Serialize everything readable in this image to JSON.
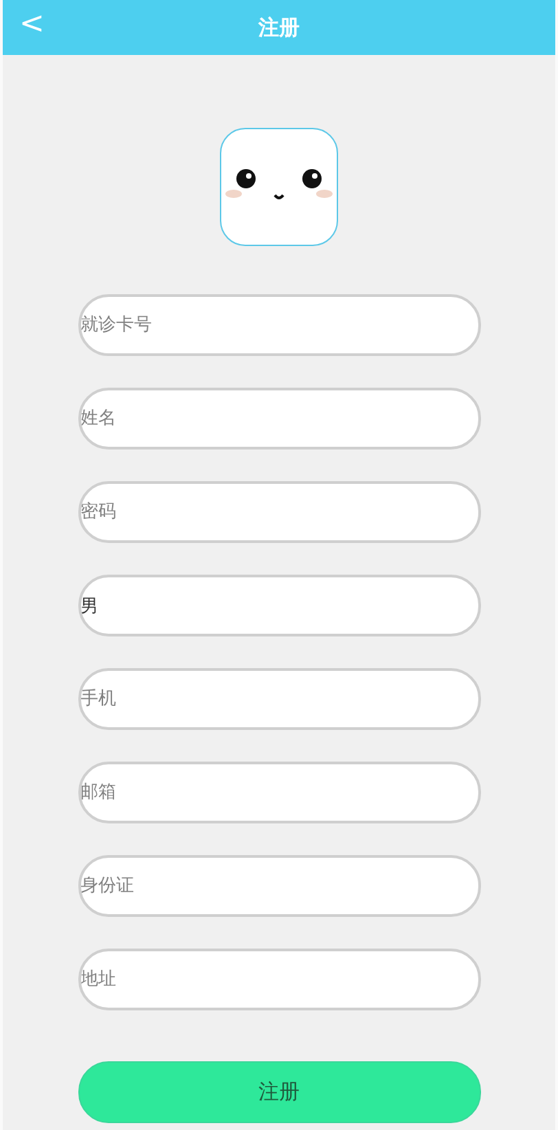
{
  "header": {
    "back": "<",
    "title": "注册"
  },
  "fields": [
    {
      "placeholder": "就诊卡号"
    },
    {
      "placeholder": "姓名"
    },
    {
      "placeholder": "密码"
    },
    {
      "value": "男"
    },
    {
      "placeholder": "手机"
    },
    {
      "placeholder": "邮箱"
    },
    {
      "placeholder": "身份证"
    },
    {
      "placeholder": "地址"
    }
  ],
  "submit": "注册"
}
